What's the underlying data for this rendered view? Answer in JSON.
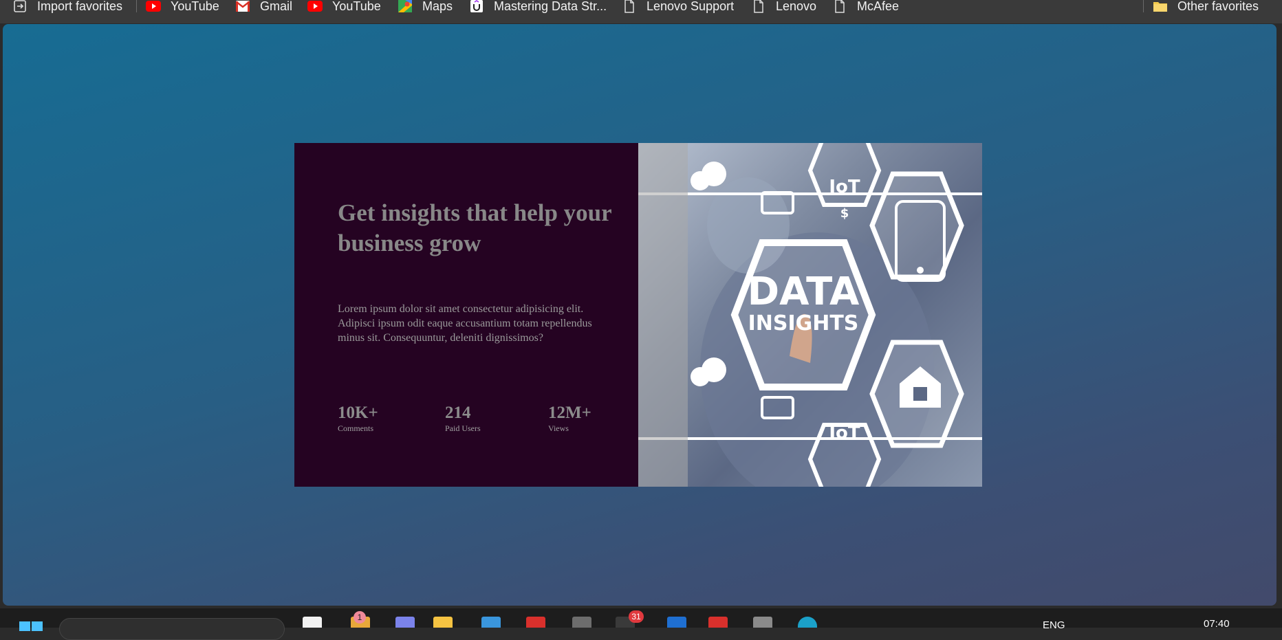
{
  "favorites_bar": {
    "items": [
      {
        "label": "Import favorites",
        "icon": "import-icon"
      },
      {
        "label": "YouTube",
        "icon": "youtube-icon"
      },
      {
        "label": "Gmail",
        "icon": "gmail-icon"
      },
      {
        "label": "YouTube",
        "icon": "youtube-icon"
      },
      {
        "label": "Maps",
        "icon": "maps-icon"
      },
      {
        "label": "Mastering Data Str...",
        "icon": "udemy-icon"
      },
      {
        "label": "Lenovo Support",
        "icon": "page-icon"
      },
      {
        "label": "Lenovo",
        "icon": "page-icon"
      },
      {
        "label": "McAfee",
        "icon": "page-icon"
      },
      {
        "label": "Other favorites",
        "icon": "folder-icon"
      }
    ]
  },
  "card": {
    "title": "Get insights that help your business grow",
    "description": "Lorem ipsum dolor sit amet consectetur adipisicing elit. Adipisci ipsum odit eaque accusantium totam repellendus minus sit. Consequuntur, deleniti dignissimos?",
    "stats": [
      {
        "value": "10K+",
        "label": "Comments"
      },
      {
        "value": "214",
        "label": "Paid Users"
      },
      {
        "value": "12M+",
        "label": "Views"
      }
    ],
    "image": {
      "headline_line1": "DATA",
      "headline_line2": "INSIGHTS",
      "badge_text": "IoT",
      "money_text": "$"
    }
  },
  "taskbar": {
    "language": "ENG",
    "time": "07:40",
    "notification_badges": [
      "1",
      "31"
    ]
  },
  "colors": {
    "card_dark": "#250322",
    "title_gray": "#888888",
    "page_gradient_top": "#176c93",
    "page_gradient_bottom": "#424a6b"
  }
}
